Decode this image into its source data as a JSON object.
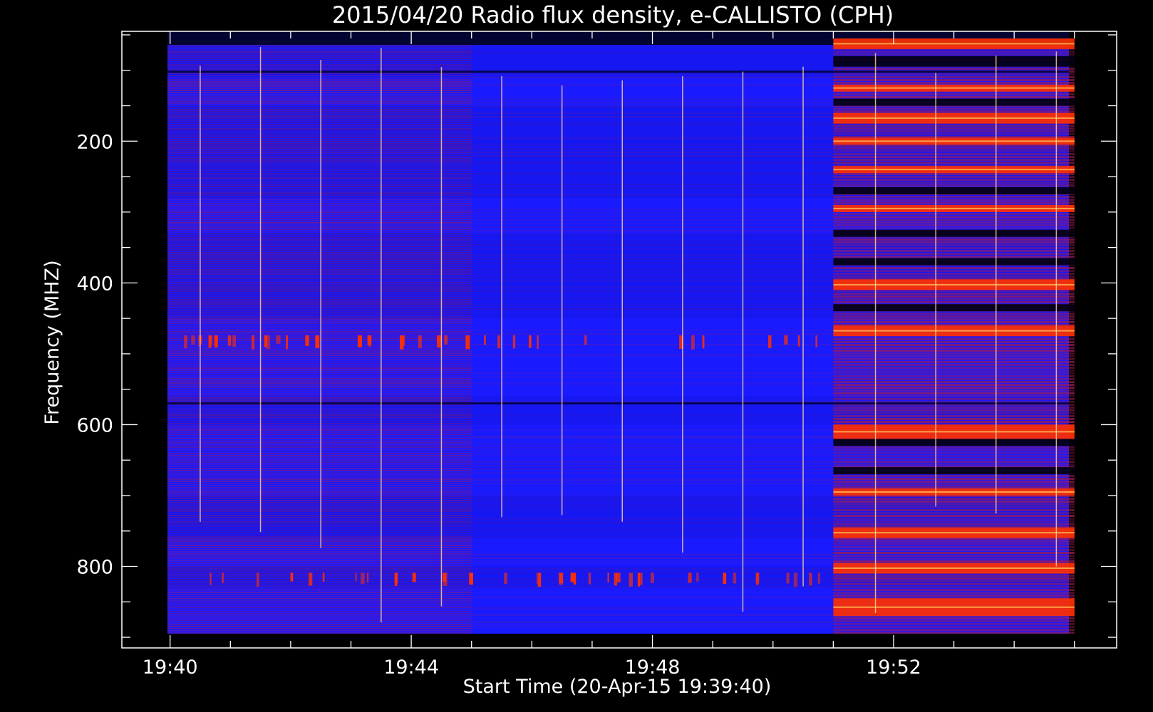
{
  "chart_data": {
    "type": "heatmap",
    "title": "2015/04/20  Radio flux density, e-CALLISTO (CPH)",
    "xlabel": "Start Time (20-Apr-15 19:39:40)",
    "ylabel": "Frequency (MHZ)",
    "x_tick_labels": [
      "19:40",
      "19:44",
      "19:48",
      "19:52"
    ],
    "x_tick_values_min": [
      0,
      4,
      8,
      12
    ],
    "xlim_min_from_1940": [
      -0.8,
      15.7
    ],
    "y_tick_labels": [
      "200",
      "400",
      "600",
      "800"
    ],
    "y_tick_values": [
      200,
      400,
      600,
      800
    ],
    "ylim_mhz": [
      45,
      915
    ],
    "colors": {
      "background": "#000000",
      "low": "#1a1aff",
      "mid": "#9a1a55",
      "high": "#ff3000",
      "peak": "#ffd060"
    },
    "features": {
      "quiet_bands_mhz": [
        [
          45,
          110
        ],
        [
          150,
          280
        ],
        [
          330,
          450
        ],
        [
          560,
          600
        ],
        [
          700,
          760
        ],
        [
          800,
          830
        ]
      ],
      "reddish_region_end_min": 5.0,
      "strong_band_start_min": 11.0,
      "strong_band_end_min": 15.0,
      "strong_bands_mhz": [
        [
          55,
          70
        ],
        [
          120,
          130
        ],
        [
          160,
          175
        ],
        [
          195,
          205
        ],
        [
          235,
          245
        ],
        [
          290,
          300
        ],
        [
          395,
          410
        ],
        [
          460,
          475
        ],
        [
          600,
          620
        ],
        [
          690,
          700
        ],
        [
          745,
          760
        ],
        [
          795,
          810
        ],
        [
          845,
          870
        ]
      ],
      "dark_bands_mhz": [
        [
          80,
          95
        ],
        [
          140,
          150
        ],
        [
          265,
          275
        ],
        [
          325,
          335
        ],
        [
          365,
          375
        ],
        [
          430,
          440
        ],
        [
          620,
          630
        ],
        [
          660,
          670
        ]
      ],
      "vertical_spikes_min": [
        0.5,
        1.5,
        2.5,
        3.5,
        4.5,
        5.5,
        6.5,
        7.5,
        8.5,
        9.5,
        10.5,
        11.7,
        12.7,
        13.7,
        14.7
      ]
    }
  }
}
